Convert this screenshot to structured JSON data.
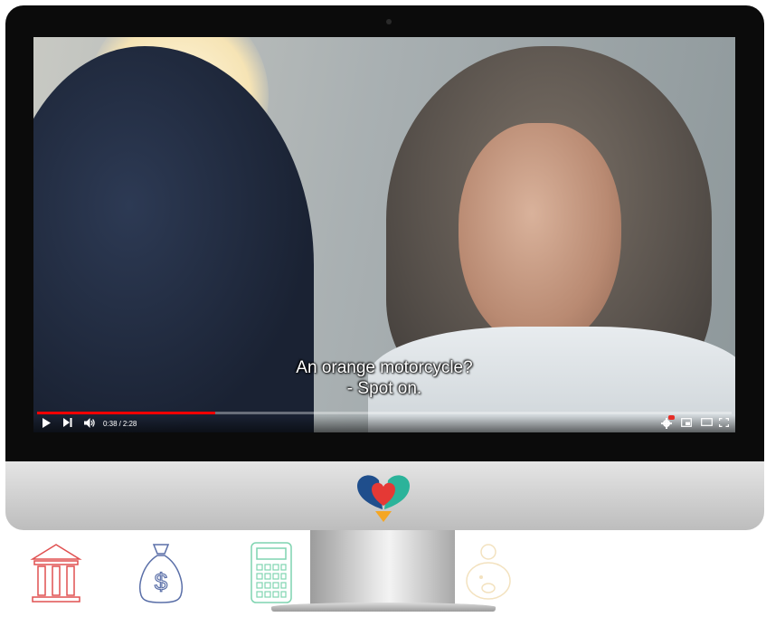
{
  "video": {
    "subtitle_line1": "An orange motorcycle?",
    "subtitle_line2": "- Spot on.",
    "current_time": "0:38",
    "duration": "2:28",
    "progress_fraction": 0.2568
  },
  "controls": {
    "play_icon": "play-icon",
    "next_icon": "skip-next-icon",
    "volume_icon": "volume-icon",
    "settings_icon": "settings-icon",
    "miniplayer_icon": "miniplayer-icon",
    "theater_icon": "theater-mode-icon",
    "fullscreen_icon": "fullscreen-icon"
  },
  "colors": {
    "progress": "#ff0000",
    "logo_blue": "#1f4e8c",
    "logo_green": "#2bb39a",
    "logo_red": "#e53935",
    "logo_orange": "#f5a623",
    "bank_icon": "#e05050",
    "money_icon": "#5a6fa8",
    "calculator_icon": "#7fd4b0",
    "piggy_icon": "#f3e2bf"
  },
  "bottom_icons": [
    "bank-icon",
    "money-bag-icon",
    "calculator-icon",
    "piggy-bank-icon"
  ]
}
